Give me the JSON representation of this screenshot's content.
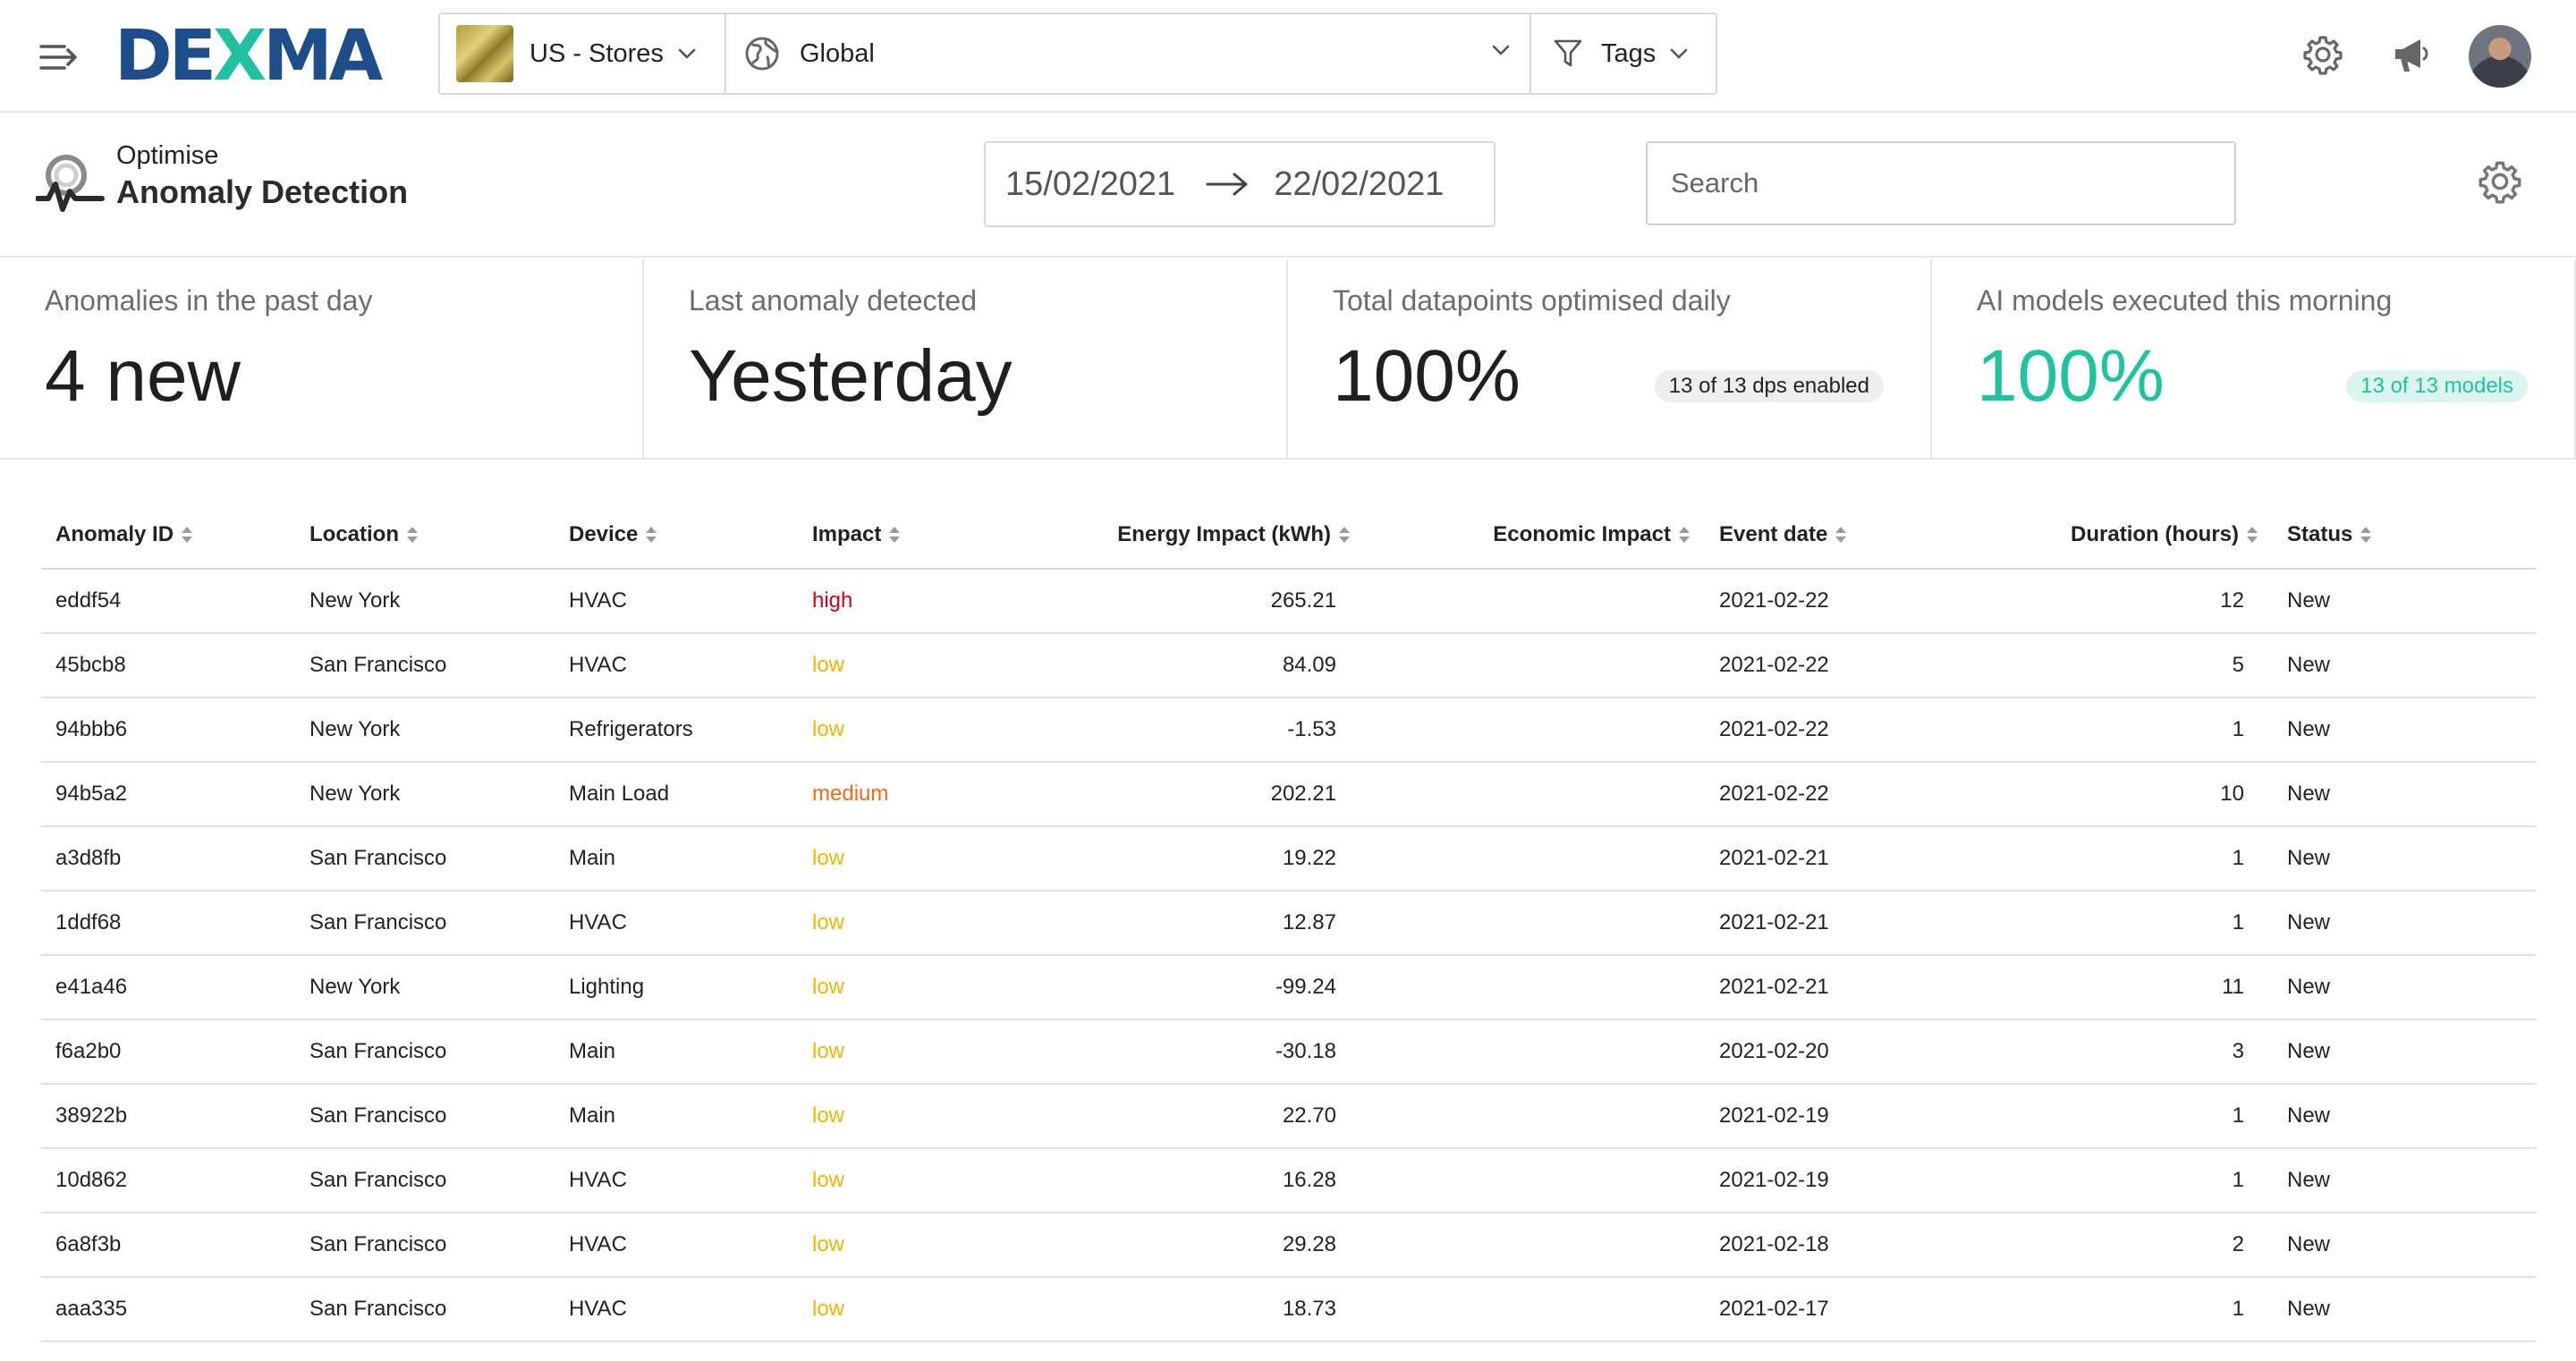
{
  "nav": {
    "brand_prefix": "DE",
    "brand_x": "X",
    "brand_suffix": "MA",
    "organization": "US - Stores",
    "location": "Global",
    "tags_label": "Tags"
  },
  "header": {
    "crumb": "Optimise",
    "title": "Anomaly Detection",
    "date_from": "15/02/2021",
    "date_to": "22/02/2021",
    "search_placeholder": "Search"
  },
  "kpis": [
    {
      "label": "Anomalies in the past day",
      "value": "4 new",
      "badge": ""
    },
    {
      "label": "Last anomaly detected",
      "value": "Yesterday",
      "badge": ""
    },
    {
      "label": "Total datapoints optimised daily",
      "value": "100%",
      "badge": "13 of 13 dps enabled"
    },
    {
      "label": "AI models executed this morning",
      "value": "100%",
      "badge": "13 of 13 models"
    }
  ],
  "colors": {
    "brand_blue": "#1d4e89",
    "brand_teal": "#20c1a0",
    "kpi_accent": "#1fc39f",
    "impact_high": "#d0021b",
    "impact_medium": "#f36b0e",
    "impact_low": "#f5b400"
  },
  "icons": {
    "menu": "menu-collapse-icon",
    "location": "globe-icon",
    "tags": "filter-icon",
    "settings": "gear-icon",
    "announcements": "megaphone-icon",
    "app": "anomaly-pulse-icon"
  },
  "table": {
    "columns": [
      "Anomaly ID",
      "Location",
      "Device",
      "Impact",
      "Energy Impact (kWh)",
      "Economic Impact",
      "Event date",
      "Duration (hours)",
      "Status"
    ],
    "rows": [
      [
        "eddf54",
        "New York",
        "HVAC",
        "high",
        "265.21",
        "",
        "2021-02-22",
        "12",
        "New"
      ],
      [
        "45bcb8",
        "San Francisco",
        "HVAC",
        "low",
        "84.09",
        "",
        "2021-02-22",
        "5",
        "New"
      ],
      [
        "94bbb6",
        "New York",
        "Refrigerators",
        "low",
        "-1.53",
        "",
        "2021-02-22",
        "1",
        "New"
      ],
      [
        "94b5a2",
        "New York",
        "Main Load",
        "medium",
        "202.21",
        "",
        "2021-02-22",
        "10",
        "New"
      ],
      [
        "a3d8fb",
        "San Francisco",
        "Main",
        "low",
        "19.22",
        "",
        "2021-02-21",
        "1",
        "New"
      ],
      [
        "1ddf68",
        "San Francisco",
        "HVAC",
        "low",
        "12.87",
        "",
        "2021-02-21",
        "1",
        "New"
      ],
      [
        "e41a46",
        "New York",
        "Lighting",
        "low",
        "-99.24",
        "",
        "2021-02-21",
        "11",
        "New"
      ],
      [
        "f6a2b0",
        "San Francisco",
        "Main",
        "low",
        "-30.18",
        "",
        "2021-02-20",
        "3",
        "New"
      ],
      [
        "38922b",
        "San Francisco",
        "Main",
        "low",
        "22.70",
        "",
        "2021-02-19",
        "1",
        "New"
      ],
      [
        "10d862",
        "San Francisco",
        "HVAC",
        "low",
        "16.28",
        "",
        "2021-02-19",
        "1",
        "New"
      ],
      [
        "6a8f3b",
        "San Francisco",
        "HVAC",
        "low",
        "29.28",
        "",
        "2021-02-18",
        "2",
        "New"
      ],
      [
        "aaa335",
        "San Francisco",
        "HVAC",
        "low",
        "18.73",
        "",
        "2021-02-17",
        "1",
        "New"
      ]
    ]
  }
}
